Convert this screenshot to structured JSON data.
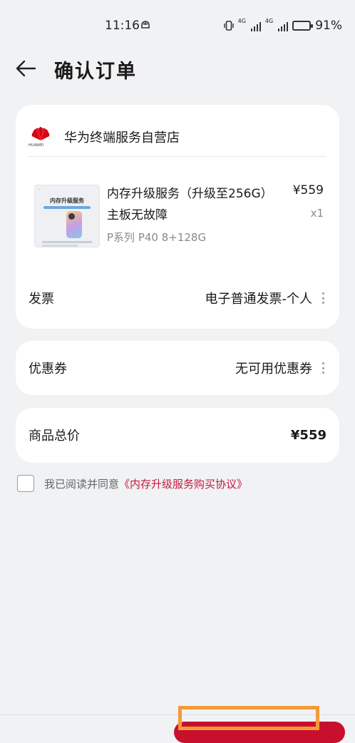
{
  "status_bar": {
    "time": "11:16",
    "network_label": "4G",
    "battery": "91%",
    "battery_level": 0.91
  },
  "header": {
    "title": "确认订单"
  },
  "store": {
    "brand": "HUAWEI",
    "name": "华为终端服务自营店"
  },
  "product": {
    "thumb_title": "内存升级服务",
    "name": "内存升级服务（升级至256G）主板无故障",
    "spec": "P系列 P40 8+128G",
    "price": "¥559",
    "qty": "x1"
  },
  "invoice": {
    "label": "发票",
    "value": "电子普通发票-个人"
  },
  "coupon": {
    "label": "优惠券",
    "value": "无可用优惠券"
  },
  "total": {
    "label": "商品总价",
    "value": "¥559"
  },
  "agreement": {
    "prefix": "我已阅读并同意",
    "link": "《内存升级服务购买协议》",
    "checked": false
  },
  "colors": {
    "accent": "#c3193f",
    "submit": "#c8102e",
    "highlight": "#f59a3a"
  }
}
